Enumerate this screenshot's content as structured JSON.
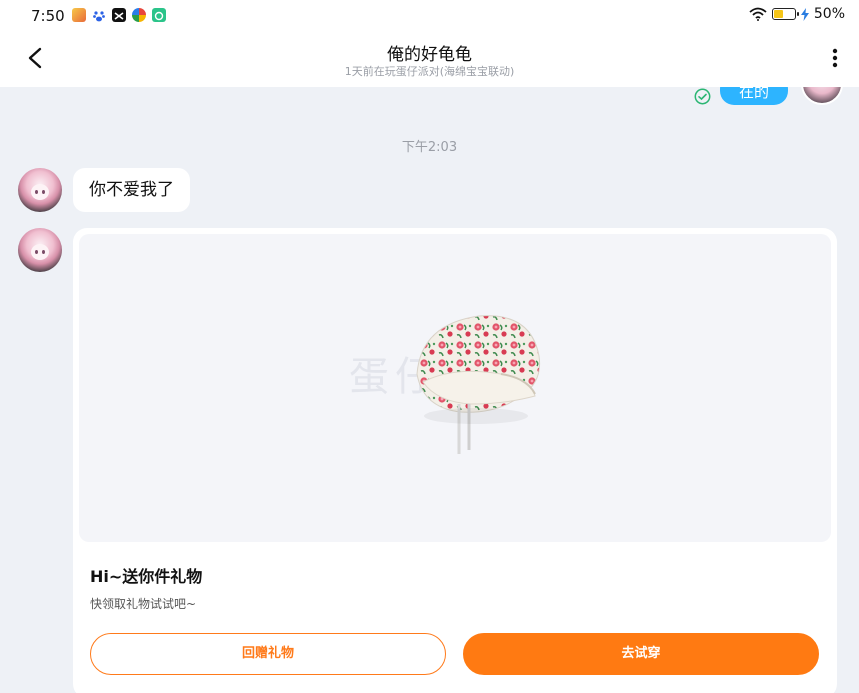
{
  "status_bar": {
    "time": "7:50",
    "battery_text": "50%",
    "battery_level": 0.5,
    "app_icons": [
      "game-app-icon",
      "baidu-paw-icon",
      "capcut-icon",
      "pinwheel-app-icon",
      "chat-app-icon"
    ],
    "icons": [
      "wifi-icon",
      "battery-icon",
      "charging-icon"
    ]
  },
  "header": {
    "title": "俺的好龟龟",
    "subtitle": "1天前在玩蛋仔派对(海绵宝宝联动)",
    "icons": [
      "back-arrow-icon",
      "more-vertical-icon"
    ]
  },
  "chat": {
    "sent_message_fragment": "在的",
    "timestamp": "下午2:03",
    "received_message": "你不爱我了",
    "gift_card": {
      "watermark": "蛋仔派对",
      "title": "Hi~送你件礼物",
      "description": "快领取礼物试试吧~",
      "return_button": "回赠礼物",
      "try_button": "去试穿"
    }
  },
  "colors": {
    "accent_orange": "#ff7a12",
    "sent_bubble_blue": "#2db4ff",
    "background": "#eef1f6"
  }
}
